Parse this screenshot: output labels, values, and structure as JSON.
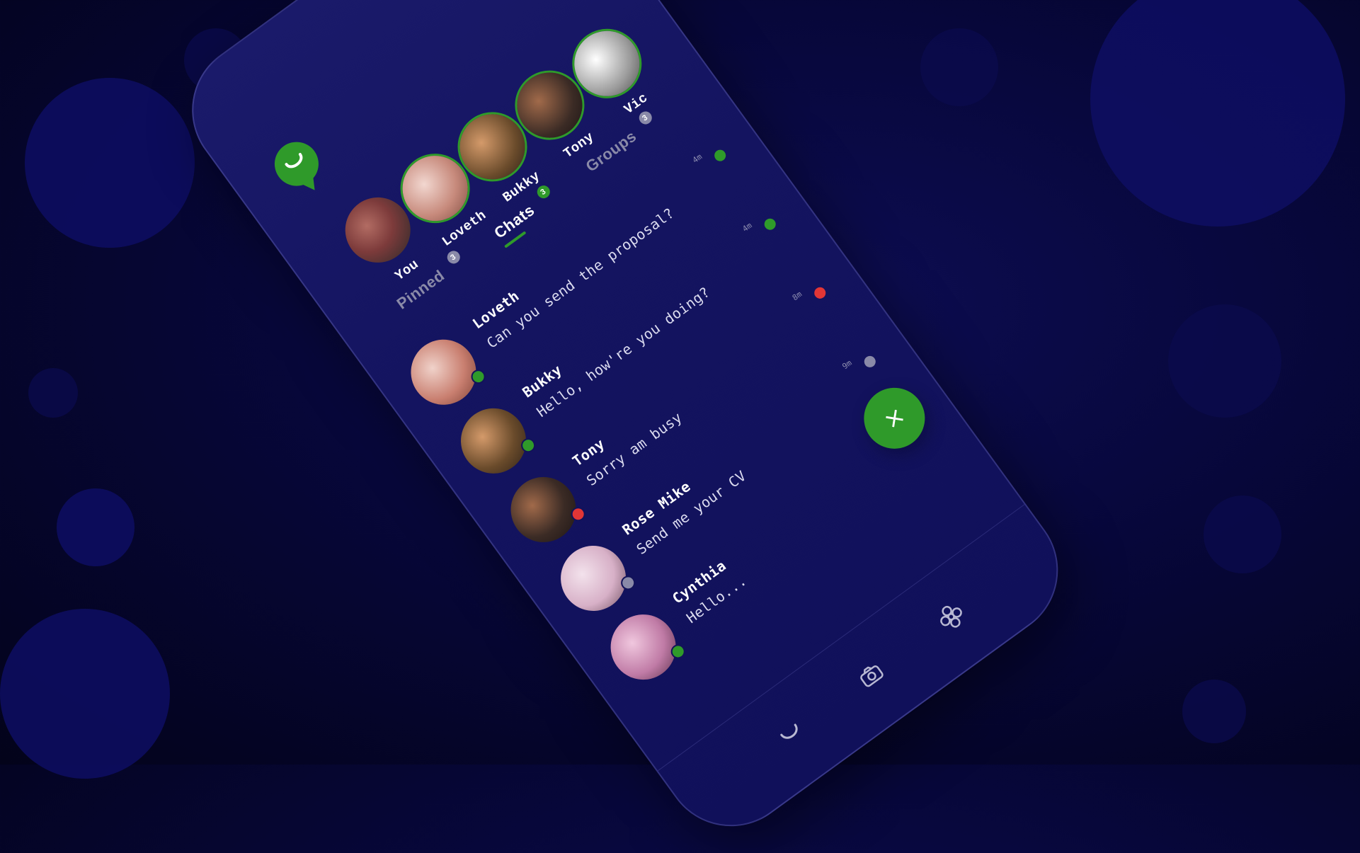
{
  "app": {
    "brand_color": "#2f9a2a",
    "background_color": "#07073a",
    "phone_color": "#141460"
  },
  "header": {
    "logo_icon": "phone-chat-icon",
    "search_icon": "search-icon"
  },
  "stories": [
    {
      "label": "You",
      "color": "#7d3b3b",
      "ring": false
    },
    {
      "label": "Loveth",
      "color": "#c78a7c",
      "ring": true
    },
    {
      "label": "Bukky",
      "color": "#6a4b2b",
      "ring": true
    },
    {
      "label": "Tony",
      "color": "#3b2b25",
      "ring": true
    },
    {
      "label": "Vic",
      "color": "#9a9a9a",
      "ring": true
    }
  ],
  "tabs": [
    {
      "label": "Pinned",
      "badge": "3",
      "badge_color": "#8a8aa8",
      "active": false
    },
    {
      "label": "Chats",
      "badge": "3",
      "badge_color": "#2f9a2a",
      "active": true
    },
    {
      "label": "Groups",
      "badge": "3",
      "badge_color": "#8a8aa8",
      "active": false
    }
  ],
  "chats": [
    {
      "name": "Loveth",
      "message": "Can you send the proposal?",
      "time": "4m",
      "avatar_color": "#c97f70",
      "presence": "#2f9a2a",
      "unread_color": "#2f9a2a"
    },
    {
      "name": "Bukky",
      "message": "Hello, how're you doing?",
      "time": "4m",
      "avatar_color": "#6a4b2b",
      "presence": "#2f9a2a",
      "unread_color": "#2f9a2a"
    },
    {
      "name": "Tony",
      "message": "Sorry am busy",
      "time": "8m",
      "avatar_color": "#3b2b25",
      "presence": "#e23636",
      "unread_color": "#e23636"
    },
    {
      "name": "Rose Mike",
      "message": "Send me your CV",
      "time": "9m",
      "avatar_color": "#d7b0c7",
      "presence": "#8a8aa8",
      "unread_color": "#8a8aa8"
    },
    {
      "name": "Cynthia",
      "message": "Hello...",
      "time": "",
      "avatar_color": "#c07ba6",
      "presence": "#2f9a2a",
      "unread_color": ""
    }
  ],
  "fab": {
    "icon": "close-icon",
    "label": "×"
  },
  "bottom_nav": [
    {
      "icon": "phone-icon"
    },
    {
      "icon": "camera-icon"
    },
    {
      "icon": "settings-flower-icon"
    }
  ]
}
